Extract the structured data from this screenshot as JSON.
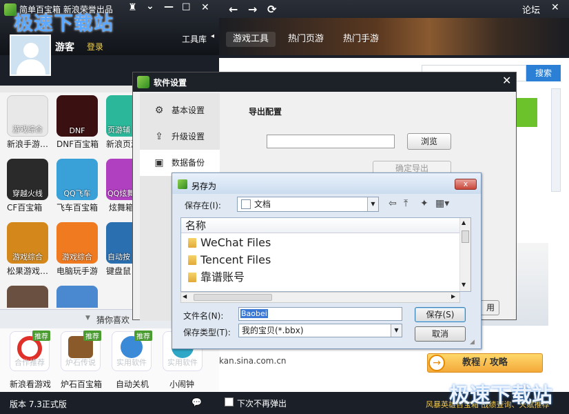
{
  "window": {
    "title": "简单百宝箱  新浪荣誉出品",
    "controls": [
      "♜",
      "⌄",
      "—",
      "☐",
      "✕"
    ],
    "nav_buttons": [
      "←",
      "→",
      "⟳"
    ],
    "forum_link": "论坛"
  },
  "watermark": "极速下载站",
  "user": {
    "name": "游客",
    "login": "登录"
  },
  "nav": {
    "toolbox": "工具库",
    "tabs": [
      "游戏工具",
      "热门页游",
      "热门手游"
    ]
  },
  "search": {
    "button": "搜索"
  },
  "apps": [
    {
      "tag": "游戏综合",
      "label": "新浪手游…",
      "color": "#e8e8e8"
    },
    {
      "tag": "DNF",
      "label": "DNF百宝箱",
      "color": "#3a1010"
    },
    {
      "tag": "页游辅",
      "label": "新浪页游",
      "color": "#2bb89a"
    },
    {
      "tag": "穿越火线",
      "label": "CF百宝箱",
      "color": "#2a2a2a"
    },
    {
      "tag": "QQ飞车",
      "label": "飞车百宝箱",
      "color": "#3aa0d8"
    },
    {
      "tag": "QQ炫舞",
      "label": "炫舞箱",
      "color": "#b040c0"
    },
    {
      "tag": "游戏综合",
      "label": "松果游戏…",
      "color": "#d4881c"
    },
    {
      "tag": "游戏综合",
      "label": "电脑玩手游",
      "color": "#f07a20"
    },
    {
      "tag": "自动按",
      "label": "键盘鼠",
      "color": "#2a6fb0"
    }
  ],
  "guess": {
    "label": "猜你喜欢"
  },
  "recommend": {
    "badge": "推荐",
    "items": [
      {
        "caption": "合作推荐",
        "label": "新浪看游戏"
      },
      {
        "caption": "炉石传说",
        "label": "炉石百宝箱"
      },
      {
        "caption": "实用软件",
        "label": "自动关机"
      },
      {
        "caption": "实用软件",
        "label": "小闹钟"
      }
    ]
  },
  "status": {
    "version": "版本 7.3正式版",
    "no_popup": "下次不再弹出",
    "right_text": "风暴英雄百宝箱 战绩查询、天赋推荐"
  },
  "page": {
    "url": "kan.sina.com.cn",
    "guide_button": "教程 / 攻略",
    "guide_icon": "→"
  },
  "settings": {
    "title": "软件设置",
    "close": "✕",
    "nav": [
      {
        "label": "基本设置",
        "icon": "⚙"
      },
      {
        "label": "升级设置",
        "icon": "⇪"
      },
      {
        "label": "数据备份",
        "icon": "▣"
      }
    ],
    "export_label": "导出配置",
    "browse": "浏览",
    "confirm_export": "确定导出",
    "hidden_btn": "用"
  },
  "saveas": {
    "title": "另存为",
    "close": "x",
    "save_in_label": "保存在(I):",
    "save_in_value": "文档",
    "column_name": "名称",
    "files": [
      "WeChat Files",
      "Tencent Files",
      "靠谱账号"
    ],
    "filename_label": "文件名(N):",
    "filename_value": "Baobei",
    "filetype_label": "保存类型(T):",
    "filetype_value": "我的宝贝(*.bbx)",
    "save_button": "保存(S)",
    "cancel_button": "取消"
  },
  "colors": {
    "accent": "#2b7fd4",
    "title_bar": "#1d2229",
    "badge": "#4a9b30"
  }
}
